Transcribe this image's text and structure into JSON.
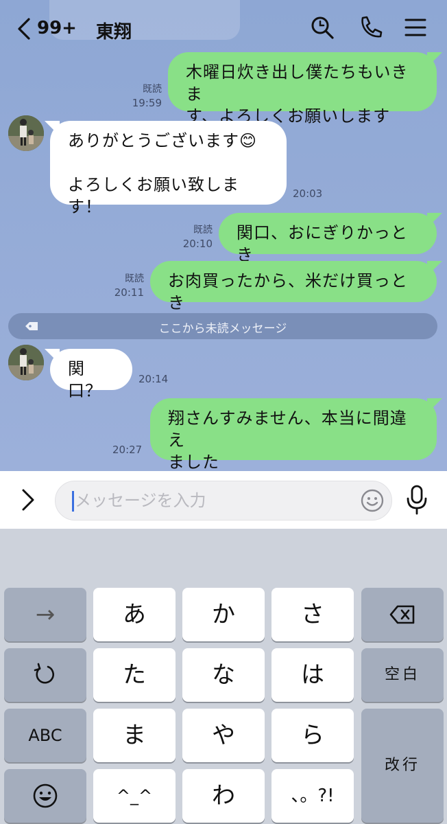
{
  "header": {
    "back_count": "99+",
    "title": "東翔"
  },
  "messages": [
    {
      "side": "me",
      "text1": "木曜日炊き出し僕たちもいきま",
      "text2": "す、よろしくお願いします",
      "read": "既読",
      "time": "19:59"
    },
    {
      "side": "them",
      "text1": "ありがとうございます😊",
      "text2": "よろしくお願い致します！",
      "time": "20:03"
    },
    {
      "side": "me",
      "text1": "関口、おにぎりかっとき",
      "read": "既読",
      "time": "20:10"
    },
    {
      "side": "me",
      "text1": "お肉買ったから、米だけ買っとき",
      "read": "既読",
      "time": "20:11"
    },
    {
      "side": "them",
      "text1": "関口？",
      "time": "20:14"
    },
    {
      "side": "me",
      "text1": "翔さんすみません、本当に間違え",
      "text2": "ました",
      "time": "20:27"
    }
  ],
  "unread_divider": "ここから未読メッセージ",
  "input": {
    "placeholder": "メッセージを入力"
  },
  "keyboard": {
    "row1": [
      "→",
      "あ",
      "か",
      "さ"
    ],
    "row2": [
      "た",
      "な",
      "は",
      "空白"
    ],
    "row3": [
      "ABC",
      "ま",
      "や",
      "ら"
    ],
    "row4": [
      "^_^",
      "わ",
      "、。?!"
    ],
    "enter": "改行"
  },
  "colors": {
    "chat_bg": "#8ea7d4",
    "my_bubble": "#89e087",
    "their_bubble": "#ffffff"
  },
  "icons": [
    "chevron-left-icon",
    "search-icon",
    "phone-icon",
    "menu-icon",
    "chevron-right-icon",
    "smiley-icon",
    "mic-icon",
    "backspace-icon",
    "undo-icon",
    "emoji-icon",
    "tag-icon"
  ]
}
